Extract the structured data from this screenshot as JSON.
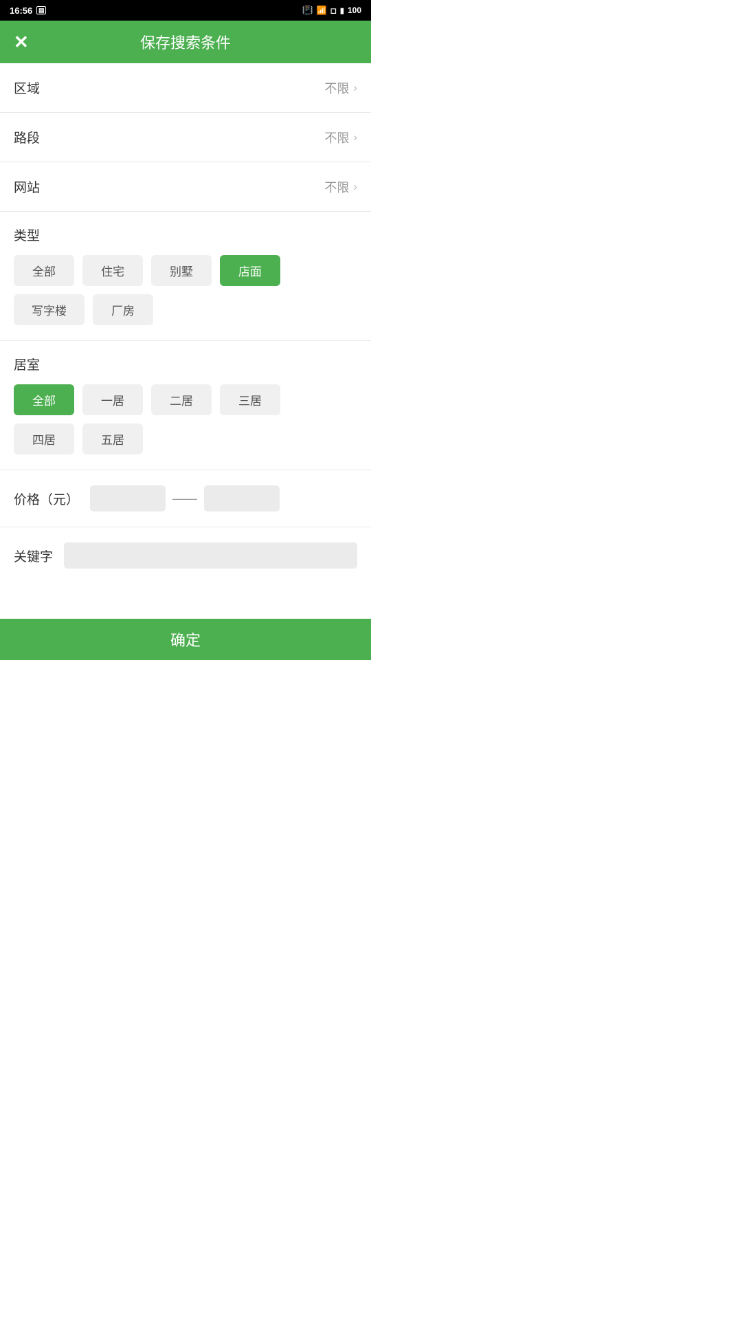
{
  "statusBar": {
    "time": "16:56",
    "battery": "100"
  },
  "header": {
    "title": "保存搜索条件",
    "closeIcon": "✕"
  },
  "rows": [
    {
      "label": "区域",
      "value": "不限"
    },
    {
      "label": "路段",
      "value": "不限"
    },
    {
      "label": "网站",
      "value": "不限"
    }
  ],
  "typeSection": {
    "title": "类型",
    "options": [
      {
        "label": "全部",
        "active": false
      },
      {
        "label": "住宅",
        "active": false
      },
      {
        "label": "别墅",
        "active": false
      },
      {
        "label": "店面",
        "active": true
      },
      {
        "label": "写字楼",
        "active": false
      },
      {
        "label": "厂房",
        "active": false
      }
    ]
  },
  "roomSection": {
    "title": "居室",
    "options": [
      {
        "label": "全部",
        "active": true
      },
      {
        "label": "一居",
        "active": false
      },
      {
        "label": "二居",
        "active": false
      },
      {
        "label": "三居",
        "active": false
      },
      {
        "label": "四居",
        "active": false
      },
      {
        "label": "五居",
        "active": false
      }
    ]
  },
  "priceSection": {
    "label": "价格（元）",
    "dashLabel": "——",
    "minPlaceholder": "",
    "maxPlaceholder": ""
  },
  "keywordSection": {
    "label": "关键字",
    "placeholder": ""
  },
  "footer": {
    "confirmLabel": "确定"
  }
}
